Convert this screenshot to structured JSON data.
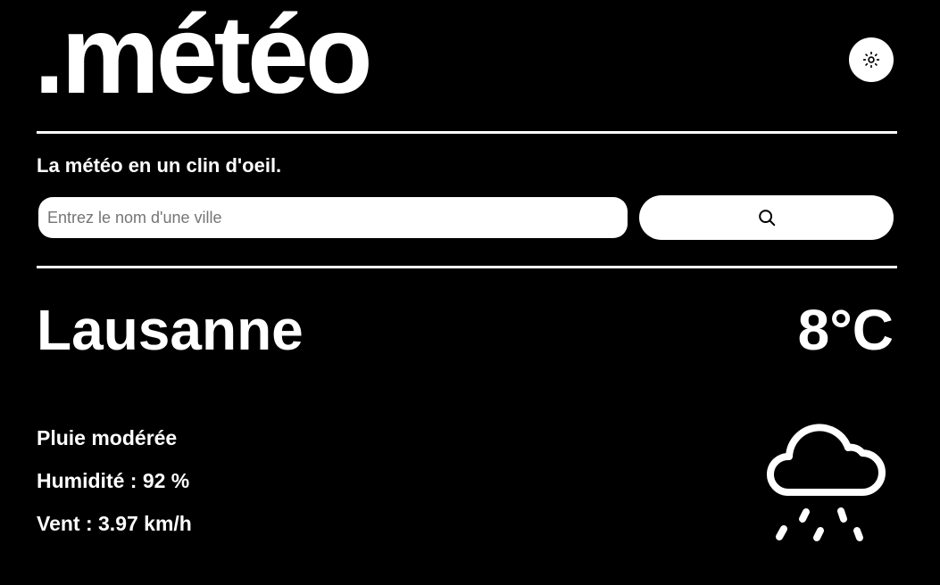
{
  "header": {
    "logo_text": ".météo",
    "theme_toggle_icon": "sun-icon"
  },
  "tagline": "La météo en un clin d'oeil.",
  "search": {
    "value": "",
    "placeholder": "Entrez le nom d'une ville",
    "button_icon": "search-icon"
  },
  "current": {
    "city": "Lausanne",
    "temperature": "8°C",
    "description": "Pluie modérée",
    "humidity": "Humidité : 92 %",
    "wind": "Vent : 3.97 km/h",
    "condition_icon": "cloud-rain-icon"
  },
  "colors": {
    "background": "#000000",
    "foreground": "#ffffff"
  }
}
